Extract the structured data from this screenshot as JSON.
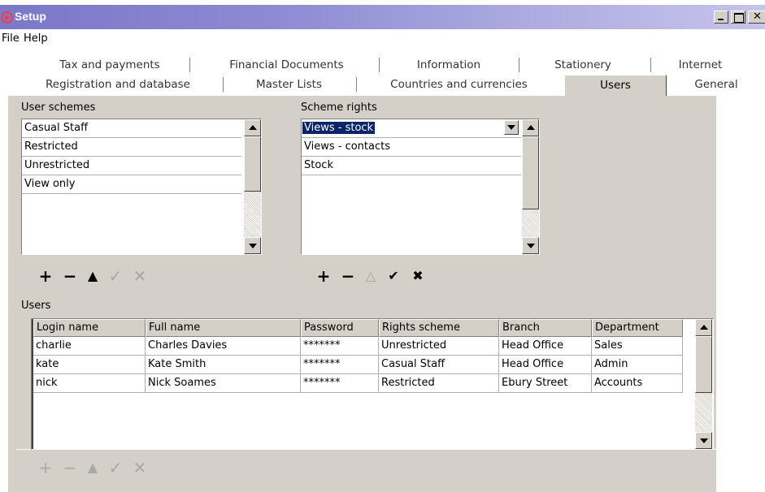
{
  "window": {
    "title": "Setup",
    "close_glyph": "✕"
  },
  "menu": [
    "File",
    "Help"
  ],
  "tabs_row1": [
    "Tax and payments",
    "Financial Documents",
    "Information",
    "Stationery",
    "Internet"
  ],
  "tabs_row2": [
    "Registration and database",
    "Master Lists",
    "Countries and currencies",
    "Users",
    "General"
  ],
  "active_tab": "Users",
  "user_schemes": {
    "label": "User schemes",
    "items": [
      "Casual Staff",
      "Restricted",
      "Unrestricted",
      "View only"
    ]
  },
  "scheme_rights": {
    "label": "Scheme rights",
    "items": [
      "Views - stock",
      "Views - contacts",
      "Stock"
    ],
    "selected": "Views - stock"
  },
  "toolbar_glyphs": {
    "add": "+",
    "remove": "−",
    "up": "▲",
    "up_outline": "△",
    "confirm": "✓",
    "cancel": "✕",
    "confirm_bold": "✔",
    "cancel_bold": "✖"
  },
  "users": {
    "label": "Users",
    "columns": [
      "Login name",
      "Full name",
      "Password",
      "Rights scheme",
      "Branch",
      "Department"
    ],
    "rows": [
      [
        "charlie",
        "Charles Davies",
        "*******",
        "Unrestricted",
        "Head Office",
        "Sales"
      ],
      [
        "kate",
        "Kate Smith",
        "*******",
        "Casual Staff",
        "Head Office",
        "Admin"
      ],
      [
        "nick",
        "Nick Soames",
        "*******",
        "Restricted",
        "Ebury Street",
        "Accounts"
      ]
    ]
  },
  "colors": {
    "titlebar_start": "#7a78c8",
    "panel": "#d4d0c8",
    "selection": "#0a246a",
    "app_logo": "#ff3b3b"
  }
}
